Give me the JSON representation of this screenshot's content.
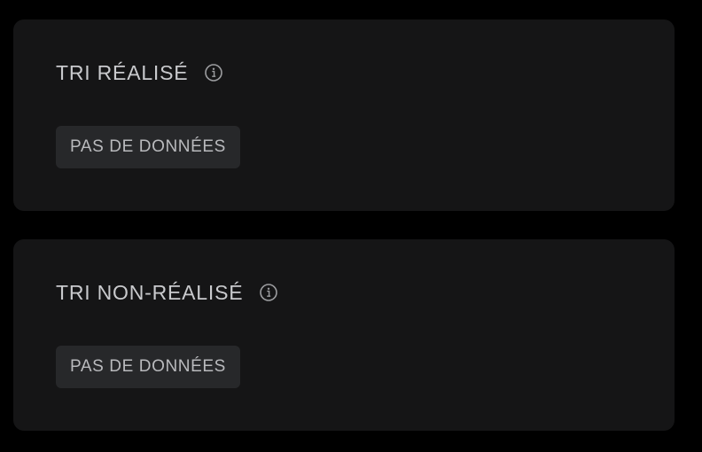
{
  "cards": [
    {
      "title": "TRI RÉALISÉ",
      "info_icon": "info-circle-icon",
      "status": "PAS DE DONNÉES"
    },
    {
      "title": "TRI NON-RÉALISÉ",
      "info_icon": "info-circle-icon",
      "status": "PAS DE DONNÉES"
    }
  ],
  "colors": {
    "background": "#000000",
    "card": "#151516",
    "badge": "#27282a",
    "text": "#c9cacd"
  }
}
